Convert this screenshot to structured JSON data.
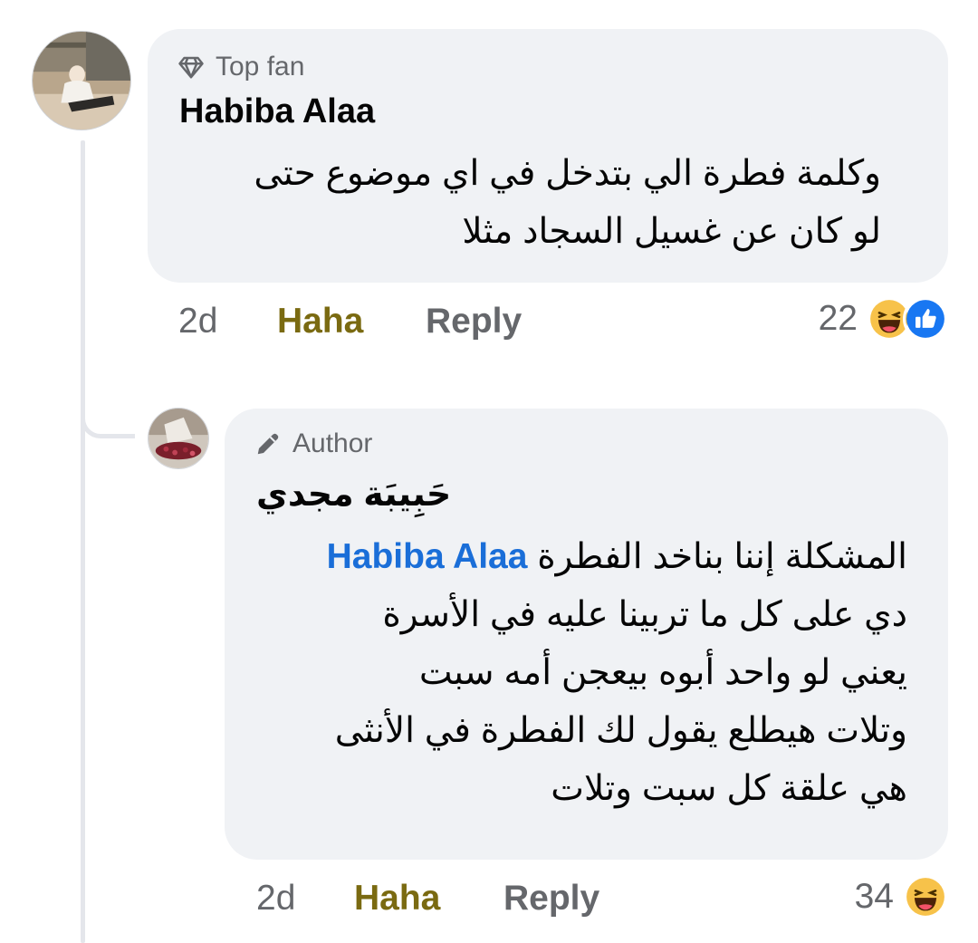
{
  "comment": {
    "badge": "Top fan",
    "author": "Habiba Alaa",
    "text_lines": [
      "وكلمة فطرة الي بتدخل في اي موضوع حتى",
      "لو كان عن غسيل السجاد مثلا"
    ],
    "time": "2d",
    "reaction_action": "Haha",
    "reply_label": "Reply",
    "reaction_count": "22",
    "reactions": [
      "haha-icon",
      "like-icon"
    ]
  },
  "reply": {
    "badge": "Author",
    "author": "حَبِيبَة مجدي",
    "mention": "Habiba Alaa",
    "first_line_text": "المشكلة إننا بناخد الفطرة",
    "text_lines": [
      "دي على كل ما تربينا عليه في الأسرة",
      "يعني لو واحد أبوه بيعجن أمه سبت",
      "وتلات هيطلع يقول لك الفطرة في الأنثى",
      "هي علقة كل سبت وتلات"
    ],
    "time": "2d",
    "reaction_action": "Haha",
    "reply_label": "Reply",
    "reaction_count": "34",
    "reactions": [
      "haha-icon"
    ]
  },
  "colors": {
    "bubble": "#f0f2f5",
    "mention": "#1a6ed8",
    "haha_action": "#7a6a11",
    "secondary_text": "#65676b",
    "like_blue": "#1877f2"
  }
}
